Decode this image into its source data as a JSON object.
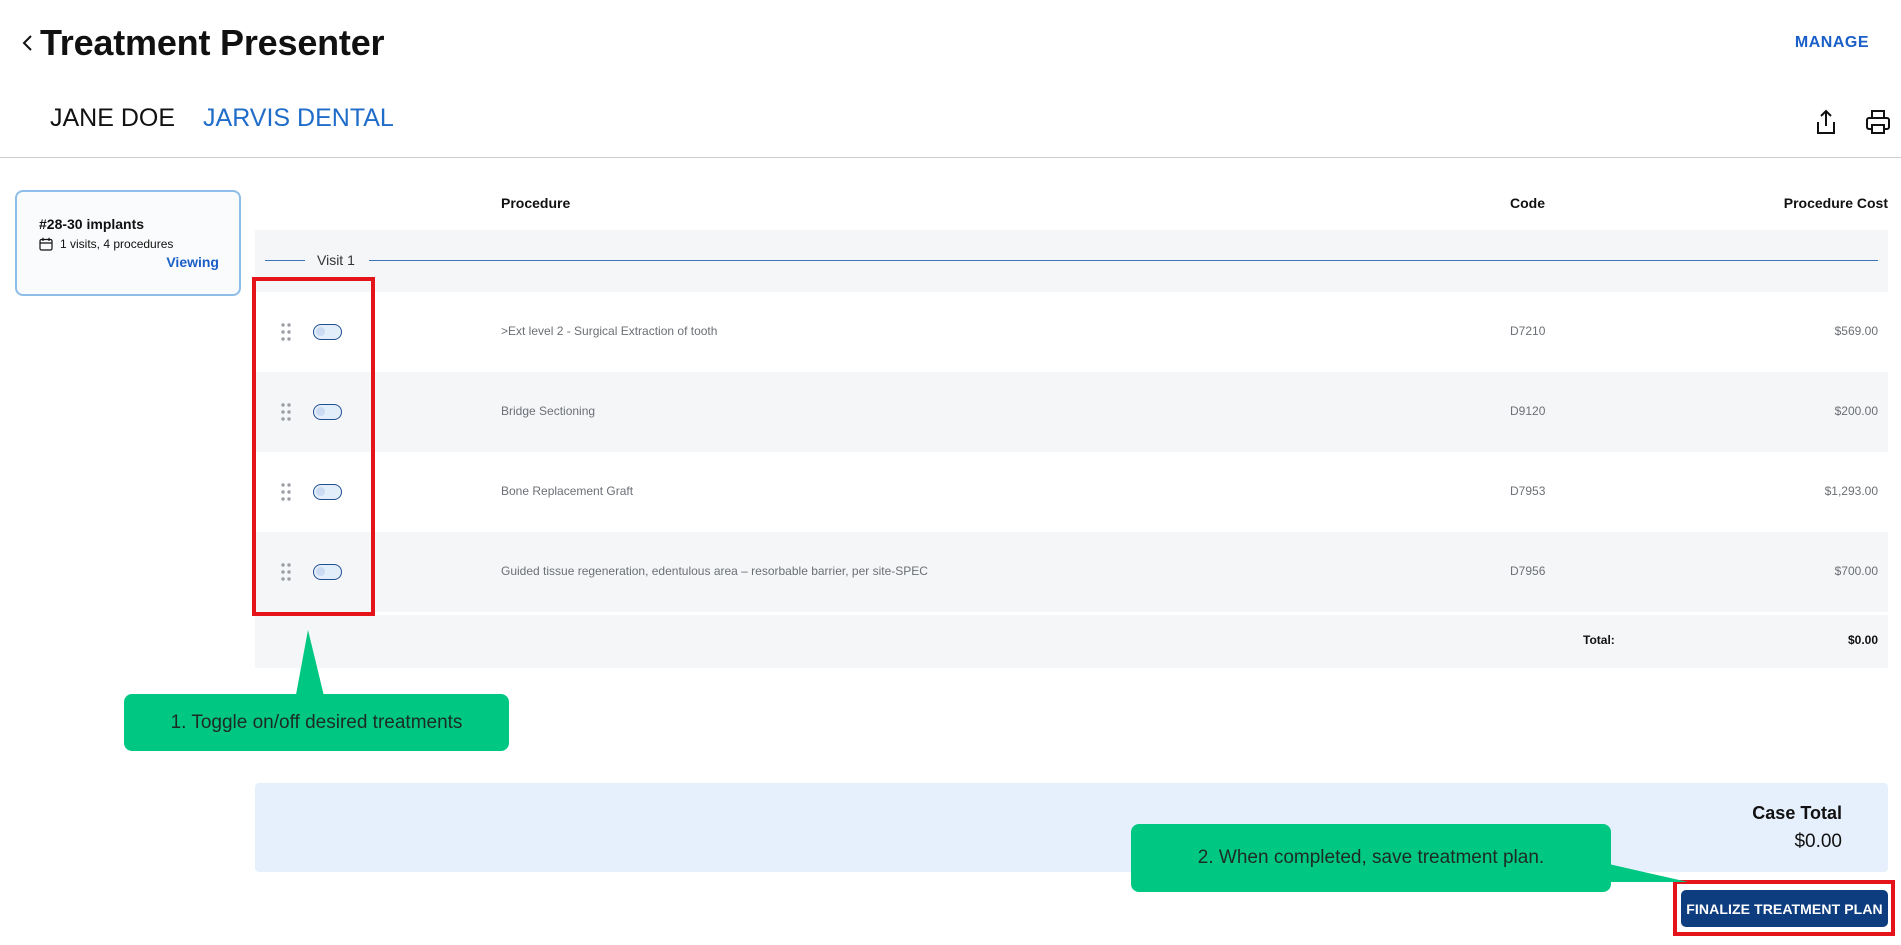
{
  "header": {
    "title": "Treatment Presenter",
    "manage_label": "MANAGE",
    "patient_name": "JANE DOE",
    "practice_name": "JARVIS DENTAL"
  },
  "plan_card": {
    "title": "#28-30 implants",
    "meta": "1 visits, 4 procedures",
    "status": "Viewing"
  },
  "table": {
    "headers": {
      "procedure": "Procedure",
      "code": "Code",
      "cost": "Procedure Cost"
    },
    "visit_label": "Visit 1",
    "rows": [
      {
        "procedure": ">Ext level 2 - Surgical Extraction of tooth",
        "code": "D7210",
        "cost": "$569.00"
      },
      {
        "procedure": "Bridge Sectioning",
        "code": "D9120",
        "cost": "$200.00"
      },
      {
        "procedure": "Bone Replacement Graft",
        "code": "D7953",
        "cost": "$1,293.00"
      },
      {
        "procedure": "Guided tissue regeneration, edentulous area – resorbable barrier, per site-SPEC",
        "code": "D7956",
        "cost": "$700.00"
      }
    ],
    "total_label": "Total:",
    "total_value": "$0.00"
  },
  "case_total": {
    "label": "Case Total",
    "value": "$0.00"
  },
  "finalize_label": "FINALIZE TREATMENT PLAN",
  "callouts": {
    "step1": "1. Toggle on/off desired treatments",
    "step2": "2. When completed, save treatment plan."
  },
  "colors": {
    "accent": "#1a5fc7",
    "button": "#0d3d7f",
    "highlight": "#e5141b",
    "callout": "#00c882"
  }
}
